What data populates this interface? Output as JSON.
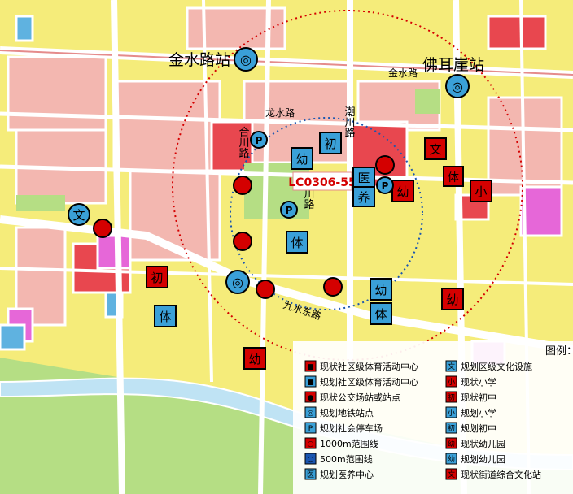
{
  "stations": {
    "jinshui_road": "金水路站",
    "foxiangya": "佛耳崖站"
  },
  "roads": {
    "jinshui_lu": "金水路",
    "longshui_lu": "龙水路",
    "qingchuan_lu": "青川路",
    "hechuan_lu": "合川路",
    "chaoshui_lu": "潮川路",
    "jiushui_lu": "九水东路"
  },
  "parcel": "LC0306-55",
  "badges": {
    "wen": "文",
    "ti": "体",
    "chu": "初",
    "you": "幼",
    "xiao": "小",
    "yi": "医",
    "yang": "养",
    "p": "P"
  },
  "legend": {
    "title": "图例：",
    "items": [
      {
        "icon": "文",
        "label": "规划区级文化设施",
        "color": "#3aa0d8"
      },
      {
        "icon": "■",
        "label": "现状社区级体育活动中心",
        "color": "#d40000"
      },
      {
        "icon": "小",
        "label": "现状小学",
        "color": "#d40000"
      },
      {
        "icon": "■",
        "label": "规划社区级体育活动中心",
        "color": "#3aa0d8"
      },
      {
        "icon": "初",
        "label": "现状初中",
        "color": "#d40000"
      },
      {
        "icon": "●",
        "label": "现状公交场站或站点",
        "color": "#d40000"
      },
      {
        "icon": "小",
        "label": "规划小学",
        "color": "#3aa0d8"
      },
      {
        "icon": "◎",
        "label": "规划地铁站点",
        "color": "#3aa0d8"
      },
      {
        "icon": "初",
        "label": "规划初中",
        "color": "#3aa0d8"
      },
      {
        "icon": "P",
        "label": "规划社会停车场",
        "color": "#3aa0d8"
      },
      {
        "icon": "幼",
        "label": "现状幼儿园",
        "color": "#d40000"
      },
      {
        "icon": "○",
        "label": "1000m范围线",
        "color": "#d40000"
      },
      {
        "icon": "幼",
        "label": "规划幼儿园",
        "color": "#3aa0d8"
      },
      {
        "icon": "○",
        "label": "500m范围线",
        "color": "#1a56b0"
      },
      {
        "icon": "文",
        "label": "现状街道综合文化站",
        "color": "#d40000"
      },
      {
        "icon": "医",
        "label": "规划医养中心",
        "color": "#3aa0d8"
      }
    ]
  }
}
